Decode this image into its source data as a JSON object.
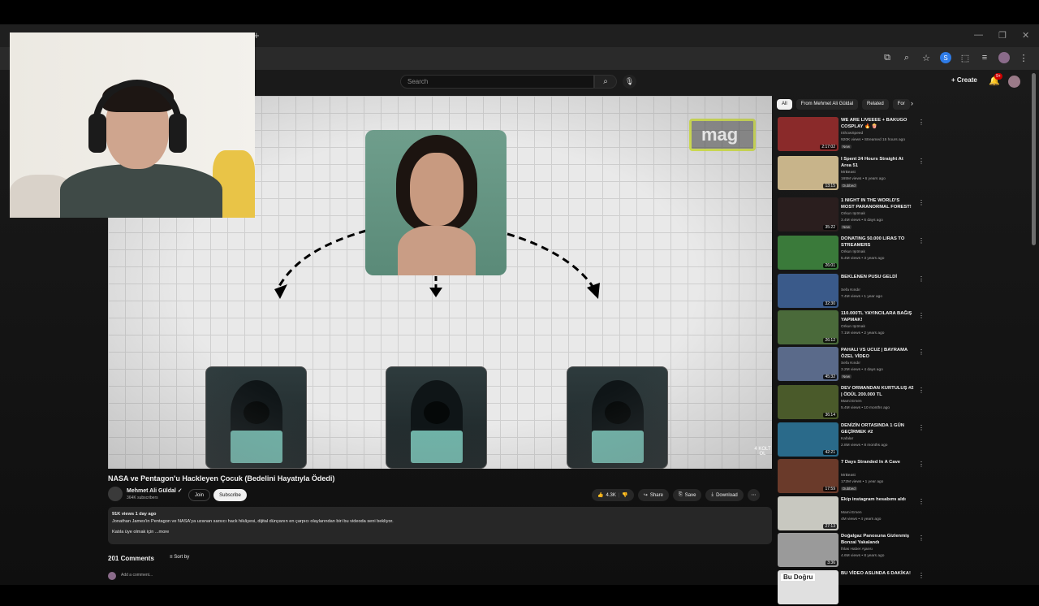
{
  "header": {
    "search_placeholder": "Search",
    "create_label": "Create",
    "notif_count": "9+"
  },
  "video": {
    "overlay_text": "mag",
    "watermark": "4 KOLT OL",
    "title": "NASA ve Pentagon'u Hackleyen Çocuk (Bedelini Hayatıyla Ödedi)"
  },
  "channel": {
    "name": "Mehmet Ali Güldal",
    "subs": "364K subscribers",
    "join": "Join",
    "subscribe": "Subscribe"
  },
  "actions": {
    "likes": "4.3K",
    "share": "Share",
    "save": "Save",
    "download": "Download"
  },
  "description": {
    "meta": "91K views  1 day ago",
    "line1": "Jonathan James'in Pentagon ve NASA'ya uzanan sarsıcı hack hikâyesi, dijital dünyanın en çarpıcı olaylarından biri bu videoda seni bekliyor.",
    "line2": "Katıla üye olmak için",
    "more": "...more"
  },
  "comments": {
    "count": "201 Comments",
    "sort": "Sort by",
    "add": "Add a comment..."
  },
  "chips": [
    "All",
    "From Mehmet Ali Güldal",
    "Related",
    "For"
  ],
  "recs": [
    {
      "title": "WE ARE LIVEEEE + BAKUGO COSPLAY 🔥 🍿",
      "channel": "IShowSpeed",
      "meta": "920K views • Streamed 15 hours ago",
      "dur": "2:17:02",
      "badge": "New",
      "color": "#8a2a2a"
    },
    {
      "title": "I Spent 24 Hours Straight At Area 51",
      "channel": "MrBeast",
      "meta": "165M views • 6 years ago",
      "dur": "13:15",
      "badge": "Dubbed",
      "color": "#c8b48a"
    },
    {
      "title": "1 NIGHT IN THE WORLD'S MOST PARANORMAL FOREST!",
      "channel": "Orkun Işıtmak",
      "meta": "3.4M views • 6 days ago",
      "dur": "35:22",
      "badge": "New",
      "color": "#2a1e1e"
    },
    {
      "title": "DONATING 50.000 LIRAS TO STREAMERS",
      "channel": "Orkun Işıtmak",
      "meta": "5.4M views • 3 years ago",
      "dur": "26:01",
      "badge": "",
      "color": "#3a7a3a"
    },
    {
      "title": "BEKLENEN PUSU GELDİ",
      "channel": "Sefa Kındır",
      "meta": "7.4M views • 1 year ago",
      "dur": "32:30",
      "badge": "",
      "color": "#3a5a8a"
    },
    {
      "title": "110.000TL YAYINCILARA BAĞIŞ YAPMAK!",
      "channel": "Orkun Işıtmak",
      "meta": "7.1M views • 2 years ago",
      "dur": "26:12",
      "badge": "",
      "color": "#4a6a3a"
    },
    {
      "title": "PAHALI VS UCUZ | BAYRAMA ÖZEL VİDEO",
      "channel": "Sefa Kındır",
      "meta": "3.2M views • 4 days ago",
      "dur": "45:32",
      "badge": "New",
      "color": "#5a6a8a"
    },
    {
      "title": "DEV ORMANDAN KURTULUŞ #2 | ÖDÜL 200.000 TL",
      "channel": "Mami Emen",
      "meta": "5.4M views • 10 months ago",
      "dur": "36:14",
      "badge": "",
      "color": "#4a5a2a"
    },
    {
      "title": "DENİZİN ORTASINDA 1 GÜN GEÇİRMEK #2",
      "channel": "Kafalar",
      "meta": "2.8M views • 8 months ago",
      "dur": "42:21",
      "badge": "",
      "color": "#2a6a8a"
    },
    {
      "title": "7 Days Stranded In A Cave",
      "channel": "MrBeast",
      "meta": "172M views • 1 year ago",
      "dur": "17:59",
      "badge": "Dubbed",
      "color": "#6a3a2a"
    },
    {
      "title": "Ekip instagram hesabımı aldı",
      "channel": "Mami Emen",
      "meta": "4M views • 4 years ago",
      "dur": "27:13",
      "badge": "",
      "color": "#c8c8c0"
    },
    {
      "title": "Doğalgaz Panosuna Gizlenmiş Bonzai Yakalandı",
      "channel": "İhlas Haber Ajansı",
      "meta": "4.6M views • 8 years ago",
      "dur": "3:36",
      "badge": "",
      "color": "#9a9a9a"
    },
    {
      "title": "BU VİDEO ASLINDA 6 DAKİKA!",
      "channel": "",
      "meta": "",
      "dur": "",
      "badge": "",
      "color": "#e0e0e0",
      "thumb_text": "Bu Doğru"
    }
  ],
  "colors": {
    "accent_yellow": "#d8e84a",
    "subscribe_bg": "#f1f1f1"
  }
}
